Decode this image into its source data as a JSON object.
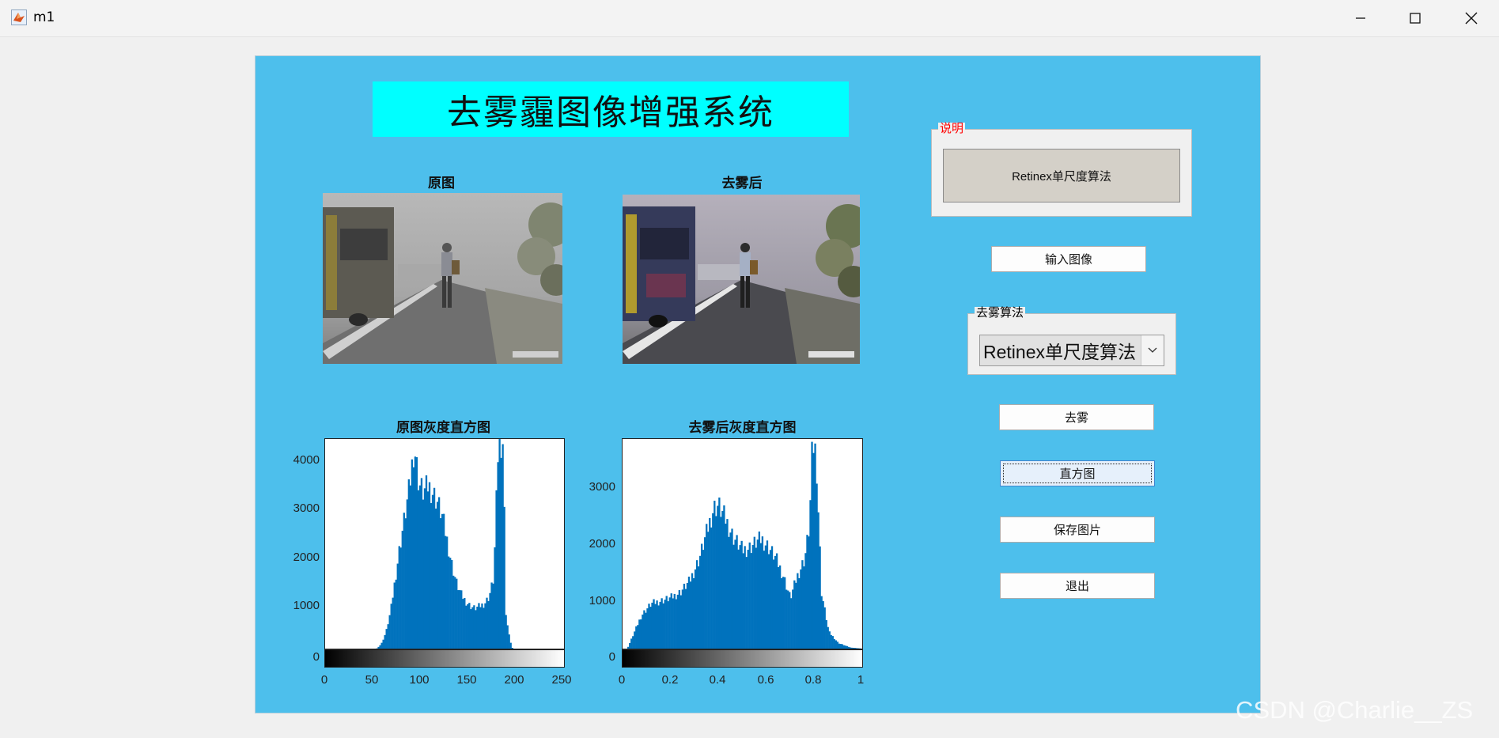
{
  "window": {
    "title": "m1",
    "minimize_icon": "minimize-icon",
    "maximize_icon": "maximize-icon",
    "close_icon": "close-icon"
  },
  "app": {
    "header": "去雾霾图像增强系统",
    "original_label": "原图",
    "dehazed_label": "去雾后",
    "original_hist_label": "原图灰度直方图",
    "dehazed_hist_label": "去雾后灰度直方图",
    "info_group_label": "说明",
    "info_text": "Retinex单尺度算法",
    "algo_group_label": "去雾算法",
    "algo_selected": "Retinex单尺度算法",
    "buttons": {
      "input_image": "输入图像",
      "dehaze": "去雾",
      "histogram": "直方图",
      "save_image": "保存图片",
      "exit": "退出"
    },
    "watermark": "CSDN @Charlie__ZS"
  },
  "colors": {
    "panel_bg": "#4dbfec",
    "banner_bg": "#00ffff",
    "hist_fill": "#0072bd",
    "info_label_color": "#ff0000"
  },
  "chart_data": [
    {
      "type": "bar",
      "title": "原图灰度直方图",
      "xlim": [
        0,
        255
      ],
      "ylim": [
        0,
        4400
      ],
      "xticks": [
        "0",
        "50",
        "100",
        "150",
        "200",
        "250"
      ],
      "yticks": [
        "0",
        "1000",
        "2000",
        "3000",
        "4000"
      ],
      "grid": false,
      "colorbar": "grayscale",
      "profile": [
        [
          0,
          0
        ],
        [
          55,
          0
        ],
        [
          60,
          100
        ],
        [
          65,
          350
        ],
        [
          70,
          800
        ],
        [
          75,
          1500
        ],
        [
          80,
          2200
        ],
        [
          85,
          2800
        ],
        [
          90,
          3400
        ],
        [
          95,
          4300
        ],
        [
          100,
          3500
        ],
        [
          105,
          3300
        ],
        [
          110,
          3450
        ],
        [
          115,
          3300
        ],
        [
          120,
          3100
        ],
        [
          125,
          2800
        ],
        [
          130,
          2300
        ],
        [
          135,
          1800
        ],
        [
          140,
          1400
        ],
        [
          145,
          1150
        ],
        [
          150,
          1000
        ],
        [
          155,
          900
        ],
        [
          160,
          850
        ],
        [
          165,
          900
        ],
        [
          170,
          950
        ],
        [
          175,
          1100
        ],
        [
          180,
          1500
        ],
        [
          185,
          4400
        ],
        [
          190,
          4400
        ],
        [
          193,
          700
        ],
        [
          197,
          200
        ],
        [
          200,
          0
        ],
        [
          255,
          0
        ]
      ]
    },
    {
      "type": "bar",
      "title": "去雾后灰度直方图",
      "xlim": [
        0,
        1
      ],
      "ylim": [
        0,
        3700
      ],
      "xticks": [
        "0",
        "0.2",
        "0.4",
        "0.6",
        "0.8",
        "1"
      ],
      "yticks": [
        "0",
        "1000",
        "2000",
        "3000"
      ],
      "grid": false,
      "colorbar": "grayscale",
      "profile": [
        [
          0,
          0
        ],
        [
          0.02,
          0
        ],
        [
          0.05,
          300
        ],
        [
          0.08,
          600
        ],
        [
          0.12,
          800
        ],
        [
          0.16,
          850
        ],
        [
          0.2,
          900
        ],
        [
          0.24,
          1000
        ],
        [
          0.28,
          1200
        ],
        [
          0.32,
          1600
        ],
        [
          0.36,
          2200
        ],
        [
          0.38,
          2500
        ],
        [
          0.4,
          2550
        ],
        [
          0.43,
          2300
        ],
        [
          0.46,
          2000
        ],
        [
          0.5,
          1750
        ],
        [
          0.53,
          1800
        ],
        [
          0.56,
          1900
        ],
        [
          0.58,
          1950
        ],
        [
          0.61,
          1800
        ],
        [
          0.64,
          1600
        ],
        [
          0.67,
          1300
        ],
        [
          0.7,
          900
        ],
        [
          0.73,
          1300
        ],
        [
          0.76,
          1600
        ],
        [
          0.78,
          2200
        ],
        [
          0.79,
          3400
        ],
        [
          0.8,
          3700
        ],
        [
          0.81,
          3200
        ],
        [
          0.83,
          1000
        ],
        [
          0.86,
          300
        ],
        [
          0.9,
          100
        ],
        [
          0.95,
          20
        ],
        [
          1,
          0
        ]
      ]
    }
  ]
}
